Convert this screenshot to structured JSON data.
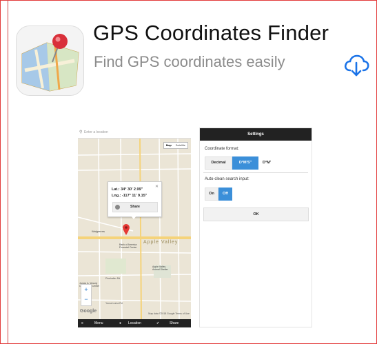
{
  "app": {
    "title": "GPS Coordinates Finder",
    "subtitle": "Find GPS coordinates easily",
    "icon": "map-pin-app-icon",
    "download_icon": "cloud-download-icon",
    "accent": "#1a73e8"
  },
  "screenshot_map": {
    "search_placeholder": "Enter a location",
    "map_toggle": [
      "Map",
      "Satellite"
    ],
    "popup": {
      "lat": "Lat.: 34° 30' 2.99\"",
      "lng": "Lng.: -117° 11' 9.15\"",
      "share": "Share"
    },
    "street_labels": [
      "Apple Valley",
      "Walgreens",
      "Bank of America Financial Center",
      "Apple Valley Animal Shelter",
      "James A. Woody Community Center",
      "Pinehalter Rd",
      "Yucca Loma Rd"
    ],
    "zoom_plus": "+",
    "zoom_minus": "−",
    "google": "Google",
    "footer": "Map data ©2018 Google   Terms of Use",
    "bottom_bar": {
      "menu": "Menu",
      "location": "Location",
      "share": "Share"
    }
  },
  "screenshot_settings": {
    "header": "Settings",
    "coord_label": "Coordinate format:",
    "coord_options": [
      "Decimal",
      "D°M'S\"",
      "D°M'"
    ],
    "coord_selected": 1,
    "autoclean_label": "Auto-clean search input:",
    "autoclean_options": [
      "On",
      "Off"
    ],
    "autoclean_selected": 1,
    "ok": "OK"
  },
  "colors": {
    "frame_border": "#e23a3a",
    "selected_segment": "#3b8fd9",
    "bar": "#222222",
    "road": "#f5d37a"
  }
}
